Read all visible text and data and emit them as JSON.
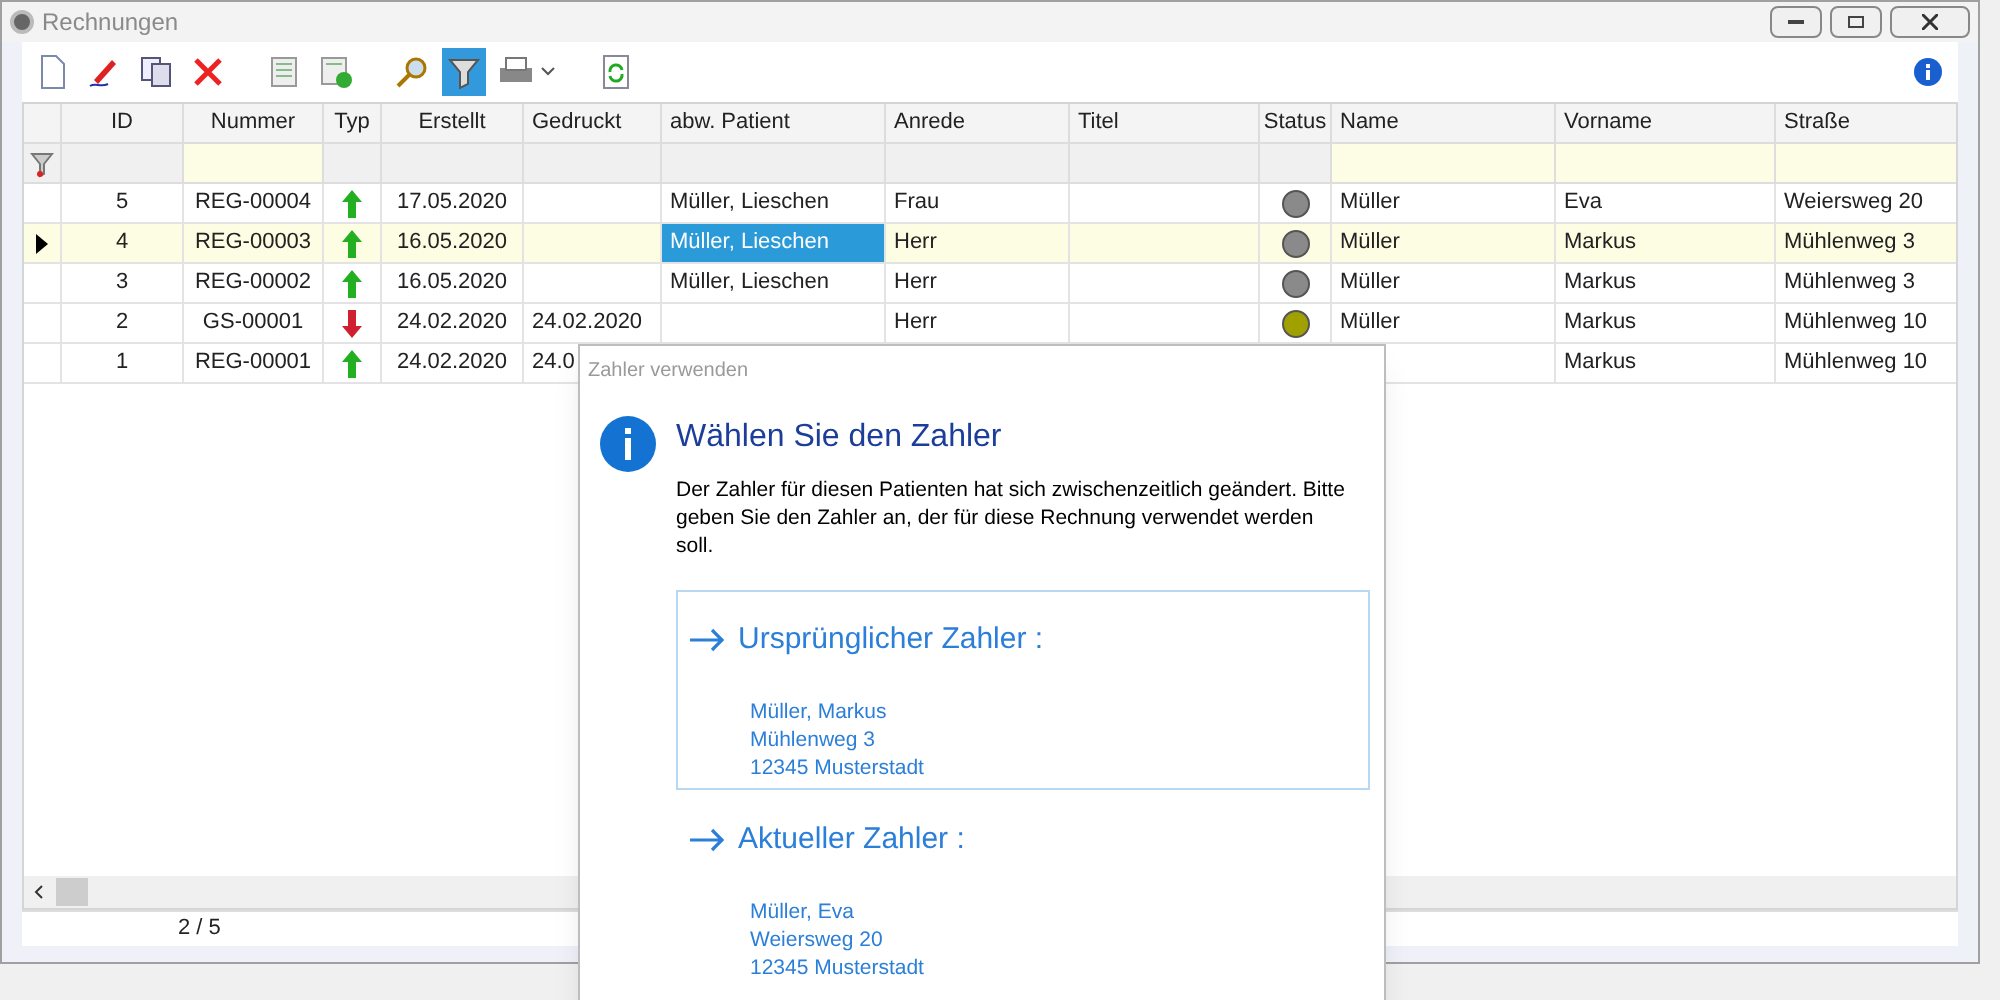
{
  "window": {
    "title": "Rechnungen"
  },
  "toolbar": [
    {
      "kind": "new",
      "selected": false
    },
    {
      "kind": "edit",
      "selected": false
    },
    {
      "kind": "copy",
      "selected": false
    },
    {
      "kind": "delete",
      "selected": false
    },
    {
      "kind": "sheet",
      "selected": false
    },
    {
      "kind": "sheet-add",
      "selected": false
    },
    {
      "kind": "search",
      "selected": false
    },
    {
      "kind": "filter",
      "selected": true
    },
    {
      "kind": "print",
      "selected": false
    },
    {
      "kind": "refresh",
      "selected": false
    }
  ],
  "table": {
    "columns": [
      "ID",
      "Nummer",
      "Typ",
      "Erstellt",
      "Gedruckt",
      "abw. Patient",
      "Anrede",
      "Titel",
      "Status",
      "Name",
      "Vorname",
      "Straße"
    ],
    "rows": [
      {
        "selected": false,
        "id": "5",
        "nummer": "REG-00004",
        "kind": "up",
        "erstellt": "17.05.2020",
        "patient": "Müller, Lieschen",
        "anrede": "Frau",
        "color": "#8a8a8a",
        "name": "Müller",
        "vorname": "Eva",
        "strasse": "Weiersweg 20"
      },
      {
        "selected": true,
        "id": "4",
        "nummer": "REG-00003",
        "kind": "up",
        "erstellt": "16.05.2020",
        "patient": "Müller, Lieschen",
        "anrede": "Herr",
        "color": "#8a8a8a",
        "name": "Müller",
        "vorname": "Markus",
        "strasse": "Mühlenweg 3"
      },
      {
        "selected": false,
        "id": "3",
        "nummer": "REG-00002",
        "kind": "up",
        "erstellt": "16.05.2020",
        "patient": "Müller, Lieschen",
        "anrede": "Herr",
        "color": "#8a8a8a",
        "name": "Müller",
        "vorname": "Markus",
        "strasse": "Mühlenweg 3"
      },
      {
        "selected": false,
        "id": "2",
        "nummer": "GS-00001",
        "kind": "down",
        "erstellt": "24.02.2020",
        "gedruckt": "24.02.2020",
        "anrede": "Herr",
        "color": "#a0a000",
        "name": "Müller",
        "vorname": "Markus",
        "strasse": "Mühlenweg 10"
      },
      {
        "selected": false,
        "id": "1",
        "nummer": "REG-00001",
        "kind": "up",
        "erstellt": "24.02.2020",
        "gedruckt": "24.0",
        "vorname": "Markus",
        "strasse": "Mühlenweg 10"
      }
    ]
  },
  "status_bar": {
    "position": "2 / 5"
  },
  "dialog": {
    "title": "Zahler verwenden",
    "heading": "Wählen Sie den Zahler",
    "message": "Der Zahler für diesen Patienten hat sich zwischenzeitlich geändert. Bitte geben Sie den Zahler an, der für diese Rechnung verwendet werden soll.",
    "options": [
      {
        "selected": true,
        "label": "Ursprünglicher Zahler :",
        "lines": [
          "Müller, Markus",
          "Mühlenweg 3",
          "12345 Musterstadt"
        ]
      },
      {
        "selected": false,
        "label": "Aktueller Zahler :",
        "lines": [
          "Müller, Eva",
          "Weiersweg 20",
          "12345 Musterstadt"
        ]
      }
    ]
  }
}
